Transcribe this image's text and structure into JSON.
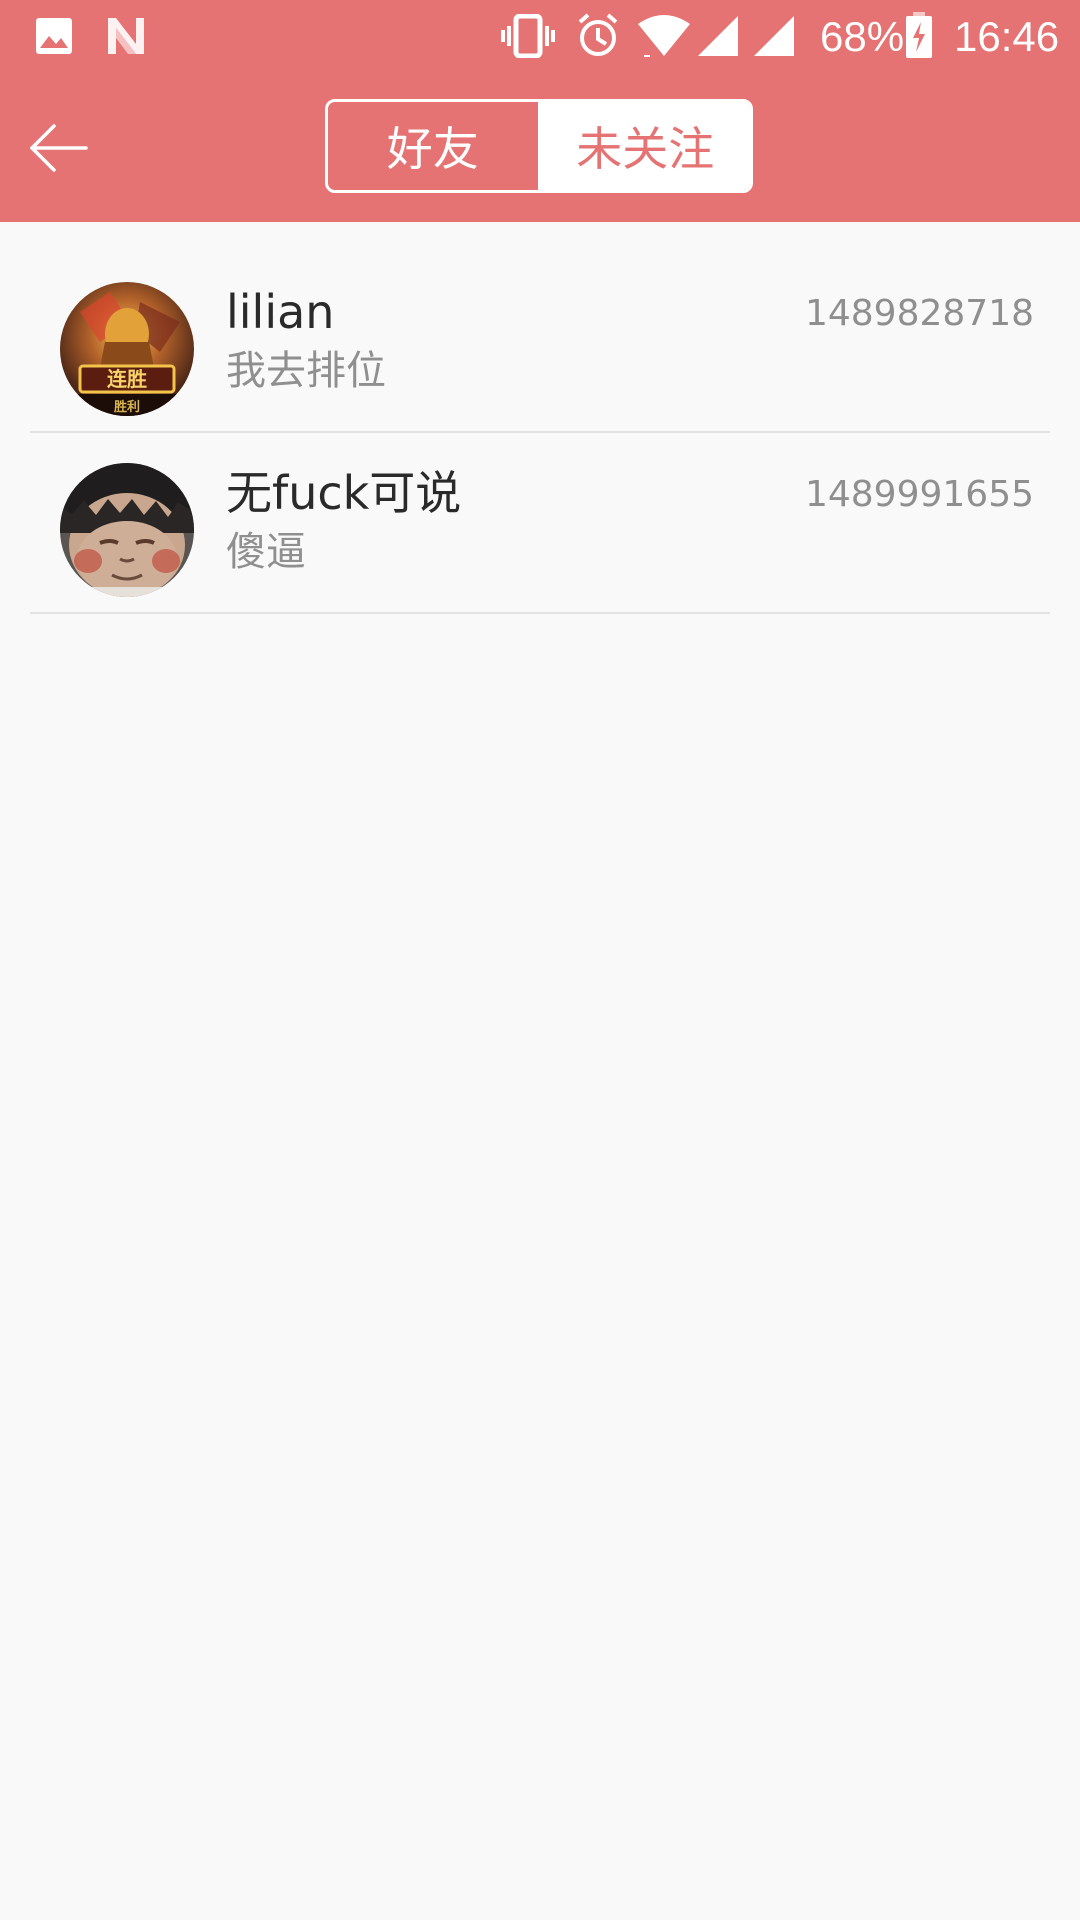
{
  "status_bar": {
    "battery": "68%",
    "time": "16:46",
    "icons": [
      "image-icon",
      "notification-n-icon",
      "vibrate-icon",
      "alarm-icon",
      "wifi-icon",
      "signal-icon",
      "signal-icon",
      "battery-charging-icon"
    ]
  },
  "toolbar": {
    "back_icon": "arrow-left-icon",
    "tabs": [
      {
        "label": "好友",
        "selected": false
      },
      {
        "label": "未关注",
        "selected": true
      }
    ]
  },
  "contacts": [
    {
      "name": "lilian",
      "message": "我去排位",
      "time": "1489828718",
      "avatar_badge_top": "连胜",
      "avatar_badge_bottom": "胜利"
    },
    {
      "name": "无fuck可说",
      "message": "傻逼",
      "time": "1489991655"
    }
  ],
  "colors": {
    "accent": "#e57373",
    "background": "#f9f9f9",
    "primary_text": "#2a2a2a",
    "secondary_text": "#8f8f8f"
  }
}
